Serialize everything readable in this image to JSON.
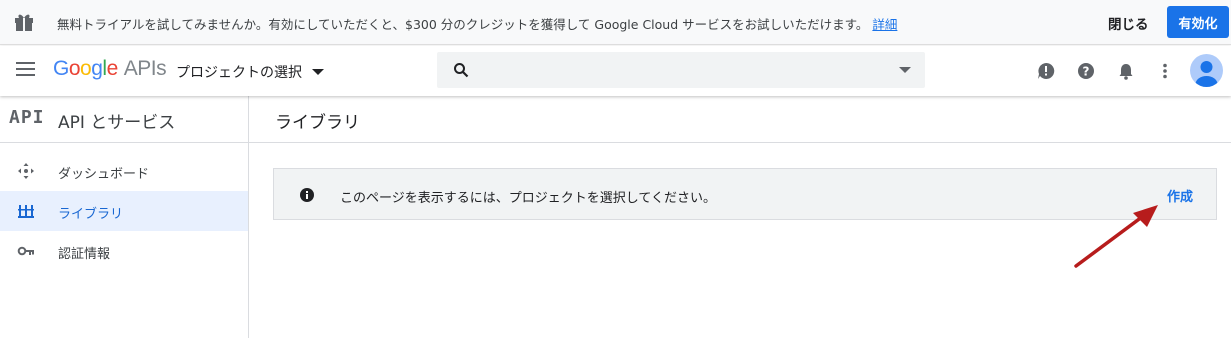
{
  "banner": {
    "message": "無料トライアルを試してみませんか。有効にしていただくと、$300 分のクレジットを獲得して Google Cloud サービスをお試しいただけます。",
    "details_link": "詳細",
    "close_label": "閉じる",
    "enable_label": "有効化",
    "icon": "gift-icon"
  },
  "header": {
    "logo_letters": [
      "G",
      "o",
      "o",
      "g",
      "l",
      "e"
    ],
    "logo_suffix": "APIs",
    "project_selector": "プロジェクトの選択",
    "search": {
      "value": "",
      "placeholder": ""
    },
    "icons": [
      "menu-icon",
      "search-icon",
      "feedback-icon",
      "help-icon",
      "notifications-icon",
      "more-vert-icon",
      "account-avatar"
    ]
  },
  "sidebar": {
    "badge": "API",
    "title": "API とサービス",
    "items": [
      {
        "label": "ダッシュボード",
        "icon": "dashboard-icon",
        "active": false
      },
      {
        "label": "ライブラリ",
        "icon": "library-icon",
        "active": true
      },
      {
        "label": "認証情報",
        "icon": "key-icon",
        "active": false
      }
    ]
  },
  "main": {
    "title": "ライブラリ",
    "notice": {
      "text": "このページを表示するには、プロジェクトを選択してください。",
      "action": "作成",
      "icon": "info-icon"
    }
  },
  "colors": {
    "accent": "#1a73e8",
    "active_bg": "#e8f0fe",
    "annotation_arrow": "#b71c1c"
  }
}
